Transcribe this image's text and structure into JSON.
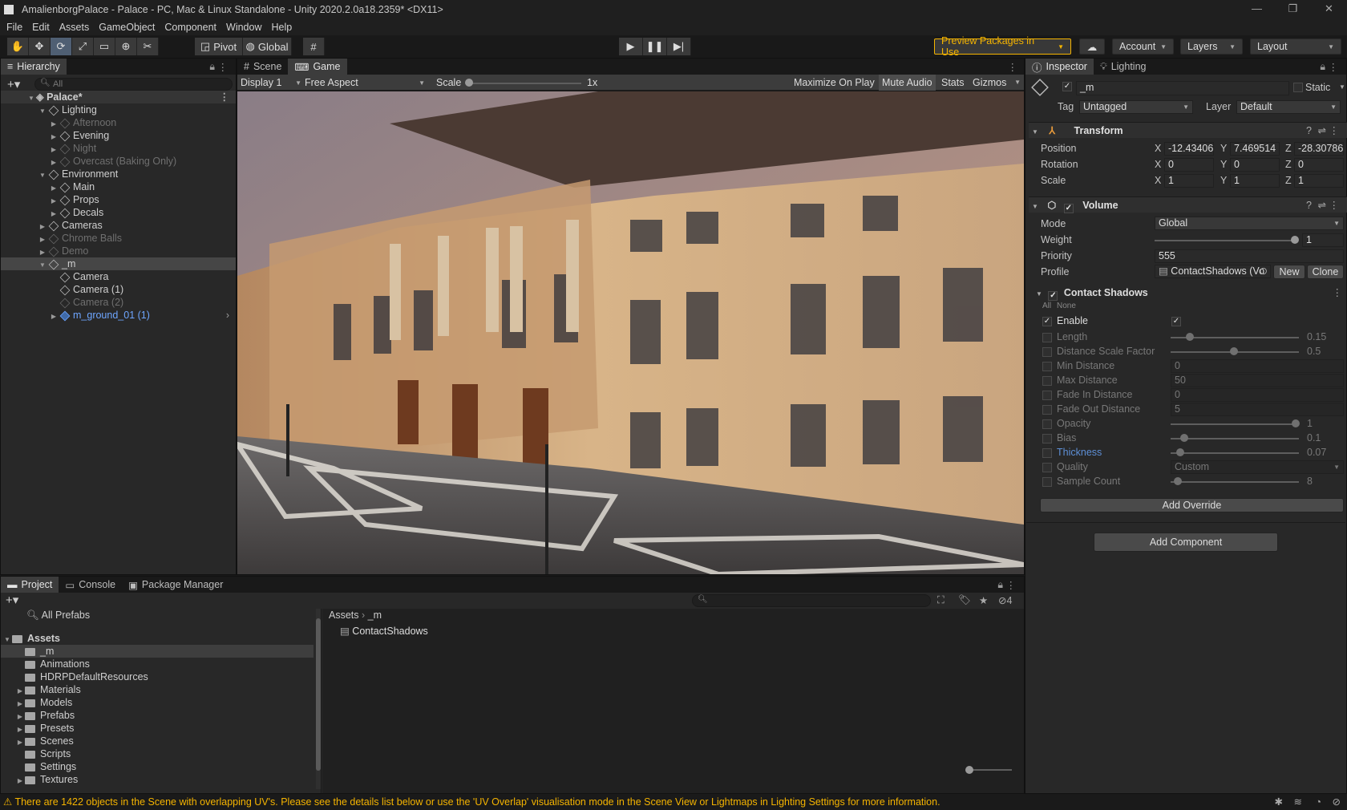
{
  "window": {
    "title": "AmalienborgPalace - Palace - PC, Mac & Linux Standalone - Unity 2020.2.0a18.2359* <DX11>"
  },
  "menu": [
    "File",
    "Edit",
    "Assets",
    "GameObject",
    "Component",
    "Window",
    "Help"
  ],
  "toolbar": {
    "pivot": "Pivot",
    "global": "Global",
    "preview_packages": "Preview Packages in Use",
    "account": "Account",
    "layers": "Layers",
    "layout": "Layout"
  },
  "hierarchy": {
    "tab": "Hierarchy",
    "search_placeholder": "All",
    "scene": "Palace*",
    "rows": [
      {
        "label": "Lighting"
      },
      {
        "label": "Afternoon"
      },
      {
        "label": "Evening"
      },
      {
        "label": "Night"
      },
      {
        "label": "Overcast (Baking Only)"
      },
      {
        "label": "Environment"
      },
      {
        "label": "Main"
      },
      {
        "label": "Props"
      },
      {
        "label": "Decals"
      },
      {
        "label": "Cameras"
      },
      {
        "label": "Chrome Balls"
      },
      {
        "label": "Demo"
      },
      {
        "label": "_m"
      },
      {
        "label": "Camera"
      },
      {
        "label": "Camera (1)"
      },
      {
        "label": "Camera (2)"
      },
      {
        "label": "m_ground_01 (1)"
      }
    ]
  },
  "game_view": {
    "tabs": [
      "Scene",
      "Game"
    ],
    "display": "Display 1",
    "aspect": "Free Aspect",
    "scale_label": "Scale",
    "scale_value": "1x",
    "scale_level": 0,
    "maximize": "Maximize On Play",
    "mute": "Mute Audio",
    "stats": "Stats",
    "gizmos": "Gizmos"
  },
  "inspector": {
    "tabs": [
      "Inspector",
      "Lighting"
    ],
    "object_name": "_m",
    "static_label": "Static",
    "tag_label": "Tag",
    "tag_value": "Untagged",
    "layer_label": "Layer",
    "layer_value": "Default",
    "transform": {
      "title": "Transform",
      "position": {
        "label": "Position",
        "x": "-12.43406",
        "y": "7.469514",
        "z": "-28.30786"
      },
      "rotation": {
        "label": "Rotation",
        "x": "0",
        "y": "0",
        "z": "0"
      },
      "scale": {
        "label": "Scale",
        "x": "1",
        "y": "1",
        "z": "1"
      },
      "axis_x": "X",
      "axis_y": "Y",
      "axis_z": "Z"
    },
    "volume": {
      "title": "Volume",
      "mode_label": "Mode",
      "mode_value": "Global",
      "weight_label": "Weight",
      "weight_value": "1",
      "priority_label": "Priority",
      "priority_value": "555",
      "profile_label": "Profile",
      "profile_value": "ContactShadows (Vo",
      "new_btn": "New",
      "clone_btn": "Clone"
    },
    "contact_shadows": {
      "title": "Contact Shadows",
      "all": "All",
      "none": "None",
      "enable_label": "Enable",
      "rows": [
        {
          "label": "Length",
          "value": "0.15",
          "level": 0.15
        },
        {
          "label": "Distance Scale Factor",
          "value": "0.5",
          "level": 0.5
        },
        {
          "label": "Min Distance",
          "value": "0"
        },
        {
          "label": "Max Distance",
          "value": "50"
        },
        {
          "label": "Fade In Distance",
          "value": "0"
        },
        {
          "label": "Fade Out Distance",
          "value": "5"
        },
        {
          "label": "Opacity",
          "value": "1",
          "level": 1
        },
        {
          "label": "Bias",
          "value": "0.1",
          "level": 0.1
        },
        {
          "label": "Thickness",
          "value": "0.07",
          "level": 0.07
        },
        {
          "label": "Quality",
          "value": "Custom"
        },
        {
          "label": "Sample Count",
          "value": "8",
          "level": 0.05
        }
      ]
    },
    "add_override": "Add Override",
    "add_component": "Add Component"
  },
  "project": {
    "tabs": [
      "Project",
      "Console",
      "Package Manager"
    ],
    "favorites": "All Prefabs",
    "assets_root": "Assets",
    "folders": [
      "_m",
      "Animations",
      "HDRPDefaultResources",
      "Materials",
      "Models",
      "Prefabs",
      "Presets",
      "Scenes",
      "Scripts",
      "Settings",
      "Textures"
    ],
    "breadcrumb": [
      "Assets",
      "_m"
    ],
    "files": [
      "ContactShadows"
    ],
    "hidden_count": "4"
  },
  "status": {
    "message": "There are 1422 objects in the Scene with overlapping UV's. Please see the details list below or use the 'UV Overlap' visualisation mode in the Scene View or Lightmaps in Lighting Settings for more information."
  },
  "colors": {
    "accent_warning": "#f5b400",
    "selection": "#4f5f73"
  }
}
